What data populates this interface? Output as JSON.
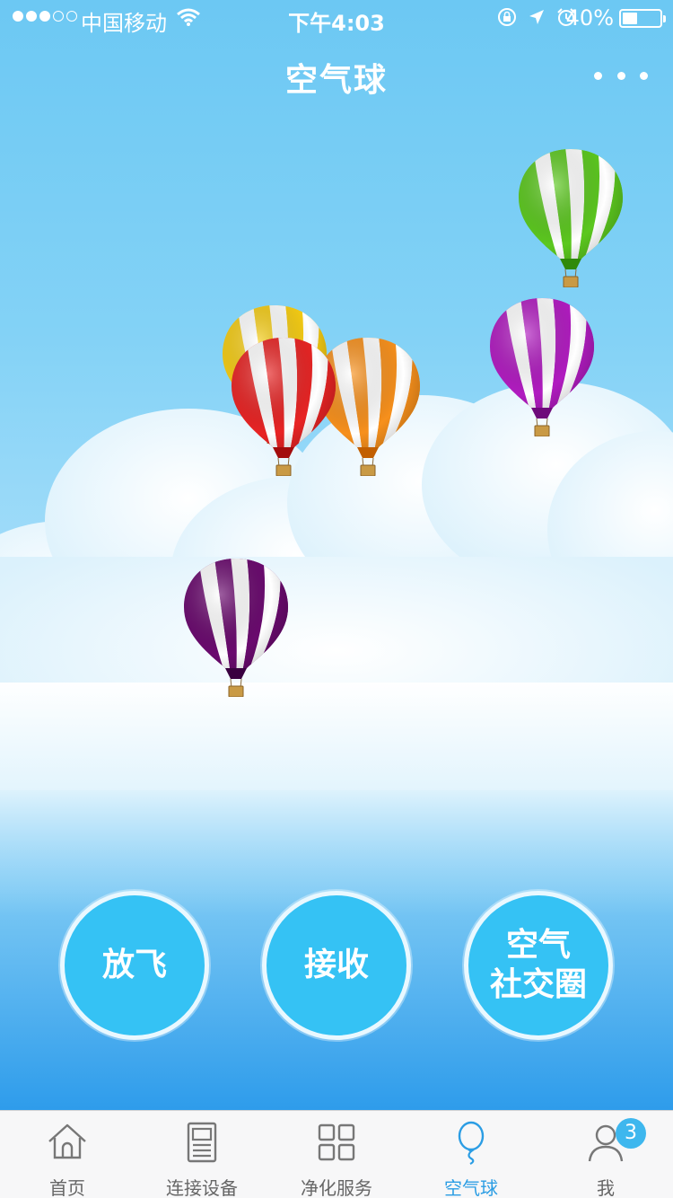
{
  "status_bar": {
    "carrier": "中国移动",
    "time": "下午4:03",
    "battery_percent": "40%",
    "battery_level": 0.4,
    "signal_bars_filled": 3,
    "signal_bars_total": 5
  },
  "nav": {
    "title": "空气球"
  },
  "actions": {
    "launch": "放飞",
    "receive": "接收",
    "social_line1": "空气",
    "social_line2": "社交圈"
  },
  "balloons": [
    {
      "name": "balloon-green",
      "color": "#5cc81f",
      "dark": "#2f8a0a"
    },
    {
      "name": "balloon-purple",
      "color": "#b11cc0",
      "dark": "#6e0a7a"
    },
    {
      "name": "balloon-yellow",
      "color": "#f5cc14",
      "dark": "#c59a00"
    },
    {
      "name": "balloon-red",
      "color": "#e82424",
      "dark": "#a30c0c"
    },
    {
      "name": "balloon-orange",
      "color": "#f7901c",
      "dark": "#c25f00"
    },
    {
      "name": "balloon-dark-purple",
      "color": "#6a0a6e",
      "dark": "#3a0040"
    }
  ],
  "tabs": [
    {
      "label": "首页",
      "icon": "home-icon"
    },
    {
      "label": "连接设备",
      "icon": "device-icon"
    },
    {
      "label": "净化服务",
      "icon": "grid-icon"
    },
    {
      "label": "空气球",
      "icon": "balloon-icon",
      "active": true
    },
    {
      "label": "我",
      "icon": "person-icon",
      "badge": "3"
    }
  ],
  "colors": {
    "sky_top": "#6cc8f3",
    "sky_bottom": "#2e9ceb",
    "button": "#35c2f4",
    "tab_active": "#2b9de4"
  }
}
